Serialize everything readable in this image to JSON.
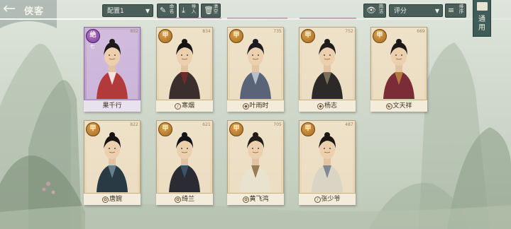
{
  "header": {
    "title": "侠客",
    "preset": "配置1",
    "buttons": [
      {
        "label": "命名",
        "icon": "pencil-icon"
      },
      {
        "label": "导入",
        "icon": "import-icon"
      },
      {
        "label": "清空",
        "icon": "trash-icon"
      }
    ],
    "view_toggle": {
      "label": "简洁",
      "icon": "eye-icon"
    },
    "sort": {
      "value": "评分"
    },
    "sort_order": {
      "label": "排序",
      "icon": "sort-icon"
    },
    "general_tab": {
      "label": "通用",
      "icon": "book-icon"
    }
  },
  "cards": [
    {
      "name": "果千行",
      "grade": "绝",
      "grade_sub": "七",
      "score": "892",
      "legend": true,
      "type_icon": "",
      "colors": {
        "robe": "#b33a3a",
        "hair": "#1f1a1a",
        "accent": "#ffffff"
      }
    },
    {
      "name": "寒烟",
      "grade": "甲",
      "grade_sub": "",
      "score": "834",
      "legend": false,
      "type_icon": "sword-icon",
      "colors": {
        "robe": "#3a2f2d",
        "hair": "#181414",
        "accent": "#7b2a2a"
      }
    },
    {
      "name": "叶雨时",
      "grade": "甲",
      "grade_sub": "",
      "score": "735",
      "legend": false,
      "type_icon": "shield-icon",
      "colors": {
        "robe": "#5a6478",
        "hair": "#1b1b22",
        "accent": "#c9cfd8"
      }
    },
    {
      "name": "杨志",
      "grade": "甲",
      "grade_sub": "",
      "score": "752",
      "legend": false,
      "type_icon": "shield-icon",
      "colors": {
        "robe": "#2c2a28",
        "hair": "#1f1d1a",
        "accent": "#8a7b60"
      }
    },
    {
      "name": "文天祥",
      "grade": "甲",
      "grade_sub": "",
      "score": "669",
      "legend": false,
      "type_icon": "yin-yang-icon",
      "colors": {
        "robe": "#7b2c36",
        "hair": "#1c1818",
        "accent": "#c08a40"
      }
    },
    {
      "name": "唐婉",
      "grade": "甲",
      "grade_sub": "",
      "score": "822",
      "legend": false,
      "type_icon": "lotus-icon",
      "colors": {
        "robe": "#2a3a44",
        "hair": "#151313",
        "accent": "#6a8fa0"
      }
    },
    {
      "name": "绮兰",
      "grade": "甲",
      "grade_sub": "",
      "score": "621",
      "legend": false,
      "type_icon": "lotus-icon",
      "colors": {
        "robe": "#2b2b33",
        "hair": "#141418",
        "accent": "#3a5c78"
      }
    },
    {
      "name": "黄飞鸿",
      "grade": "甲",
      "grade_sub": "",
      "score": "705",
      "legend": false,
      "type_icon": "lotus-icon",
      "colors": {
        "robe": "#e8e2cf",
        "hair": "#221c18",
        "accent": "#8a6b3e"
      }
    },
    {
      "name": "张少爷",
      "grade": "甲",
      "grade_sub": "",
      "score": "487",
      "legend": false,
      "type_icon": "sword-icon",
      "colors": {
        "robe": "#d9d4c3",
        "hair": "#1a1714",
        "accent": "#6e7a88"
      }
    }
  ]
}
